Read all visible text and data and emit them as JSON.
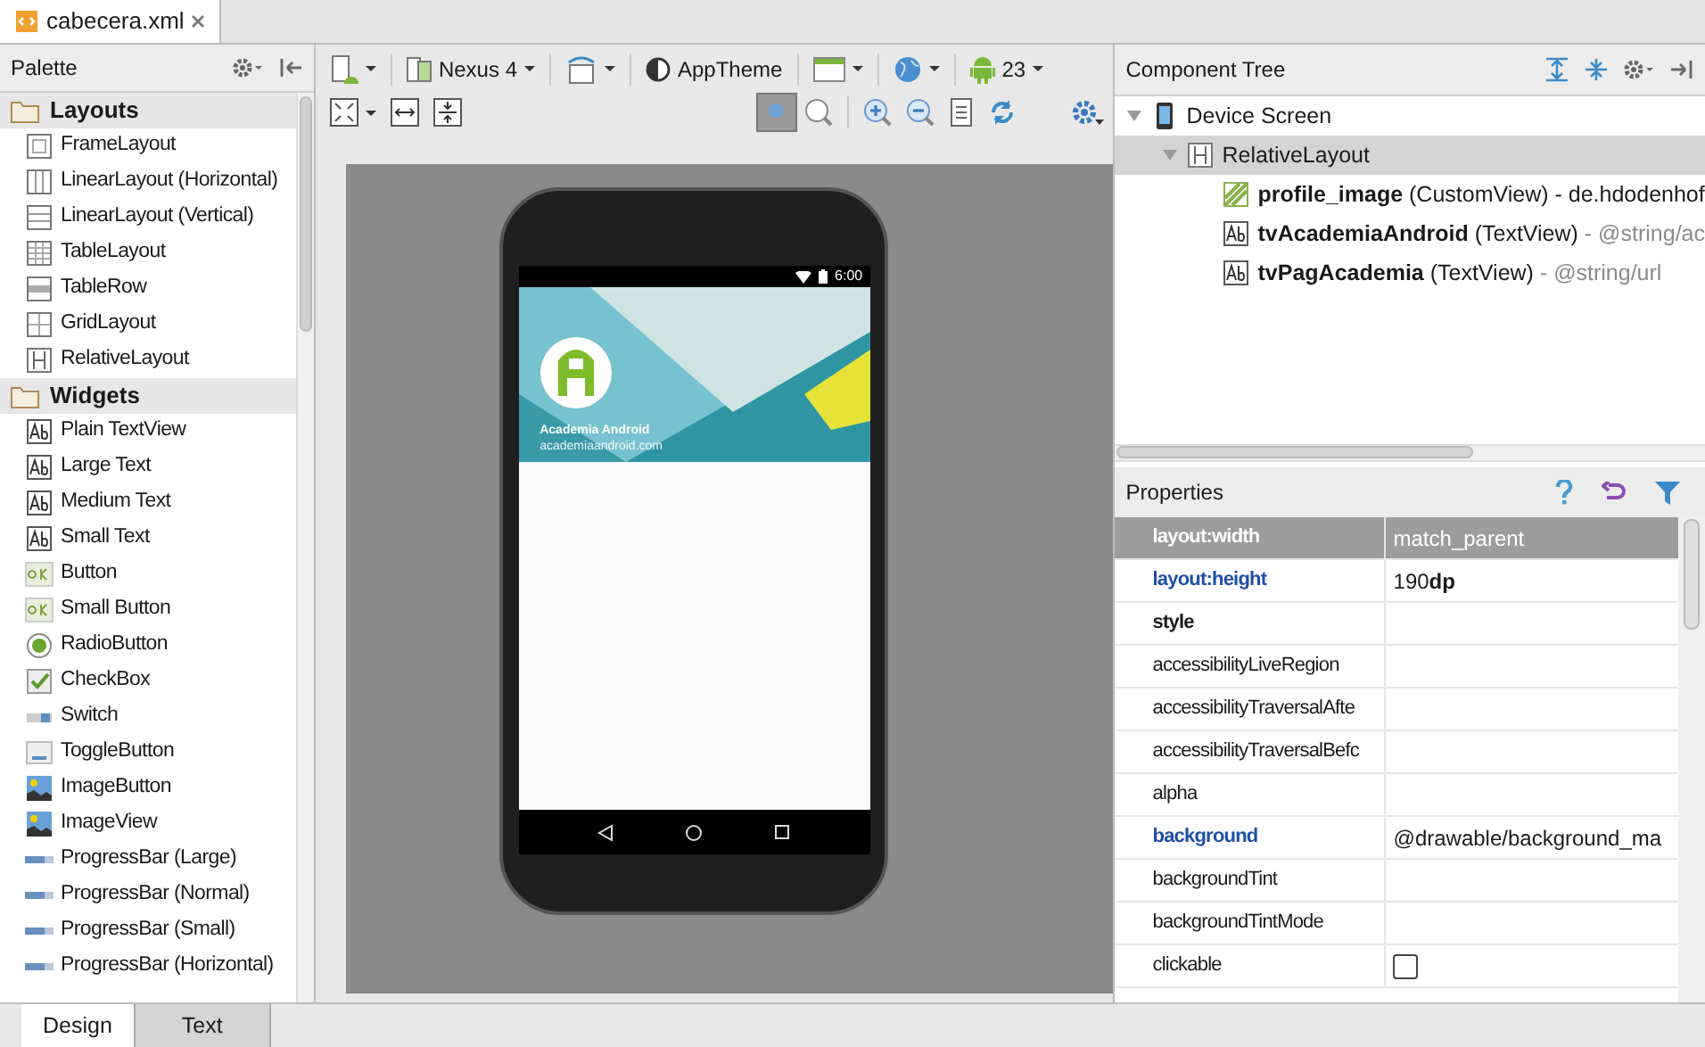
{
  "editor_tab": {
    "title": "cabecera.xml"
  },
  "palette": {
    "title": "Palette",
    "groups": [
      {
        "label": "Layouts",
        "items": [
          {
            "label": "FrameLayout",
            "kind": "frame"
          },
          {
            "label": "LinearLayout (Horizontal)",
            "kind": "linear_h"
          },
          {
            "label": "LinearLayout (Vertical)",
            "kind": "linear_v"
          },
          {
            "label": "TableLayout",
            "kind": "table"
          },
          {
            "label": "TableRow",
            "kind": "tablerow"
          },
          {
            "label": "GridLayout",
            "kind": "grid"
          },
          {
            "label": "RelativeLayout",
            "kind": "relative"
          }
        ]
      },
      {
        "label": "Widgets",
        "items": [
          {
            "label": "Plain TextView",
            "kind": "text"
          },
          {
            "label": "Large Text",
            "kind": "text"
          },
          {
            "label": "Medium Text",
            "kind": "text"
          },
          {
            "label": "Small Text",
            "kind": "text"
          },
          {
            "label": "Button",
            "kind": "button"
          },
          {
            "label": "Small Button",
            "kind": "button"
          },
          {
            "label": "RadioButton",
            "kind": "radio"
          },
          {
            "label": "CheckBox",
            "kind": "checkbox"
          },
          {
            "label": "Switch",
            "kind": "switch"
          },
          {
            "label": "ToggleButton",
            "kind": "toggle"
          },
          {
            "label": "ImageButton",
            "kind": "image"
          },
          {
            "label": "ImageView",
            "kind": "image"
          },
          {
            "label": "ProgressBar (Large)",
            "kind": "progress"
          },
          {
            "label": "ProgressBar (Normal)",
            "kind": "progress"
          },
          {
            "label": "ProgressBar (Small)",
            "kind": "progress"
          },
          {
            "label": "ProgressBar (Horizontal)",
            "kind": "progress"
          }
        ]
      }
    ]
  },
  "toolbar": {
    "device": "Nexus 4",
    "theme": "AppTheme",
    "api": "23"
  },
  "preview": {
    "status_time": "6:00",
    "header_title": "Academia Android",
    "header_subtitle": "academiaandroid.com"
  },
  "component_tree": {
    "title": "Component Tree",
    "nodes": [
      {
        "name": "Device Screen",
        "kind": "device",
        "expanded": true,
        "selected": false,
        "children": [
          {
            "name": "RelativeLayout",
            "kind": "relative",
            "expanded": true,
            "selected": true,
            "children": [
              {
                "name": "profile_image",
                "type": " (CustomView)",
                "detail": " - de.hdodenhof",
                "detail_muted": false,
                "kind": "custom",
                "selected": false
              },
              {
                "name": "tvAcademiaAndroid",
                "type": " (TextView)",
                "detail": " - @string/ac",
                "detail_muted": true,
                "kind": "text",
                "selected": false
              },
              {
                "name": "tvPagAcademia",
                "type": " (TextView)",
                "detail": " - @string/url",
                "detail_muted": true,
                "kind": "text",
                "selected": false
              }
            ]
          }
        ]
      }
    ]
  },
  "properties": {
    "title": "Properties",
    "rows": [
      {
        "name": "layout:width",
        "value": "match_parent",
        "kind": "set",
        "selected": true
      },
      {
        "name": "layout:height",
        "value": "190**dp**",
        "kind": "set",
        "selected": false
      },
      {
        "name": "style",
        "kind": "key",
        "selected": false
      },
      {
        "name": "accessibilityLiveRegion",
        "kind": "plain",
        "selected": false
      },
      {
        "name": "accessibilityTraversalAfte",
        "kind": "plain",
        "selected": false
      },
      {
        "name": "accessibilityTraversalBefc",
        "kind": "plain",
        "selected": false
      },
      {
        "name": "alpha",
        "kind": "plain",
        "selected": false
      },
      {
        "name": "background",
        "value": "@drawable/background_ma",
        "kind": "set",
        "selected": false
      },
      {
        "name": "backgroundTint",
        "kind": "plain",
        "selected": false
      },
      {
        "name": "backgroundTintMode",
        "kind": "plain",
        "selected": false
      },
      {
        "name": "clickable",
        "kind": "checkbox",
        "checked": false,
        "selected": false
      }
    ]
  },
  "bottom_tabs": [
    {
      "label": "Design",
      "selected": true
    },
    {
      "label": "Text",
      "selected": false
    }
  ]
}
